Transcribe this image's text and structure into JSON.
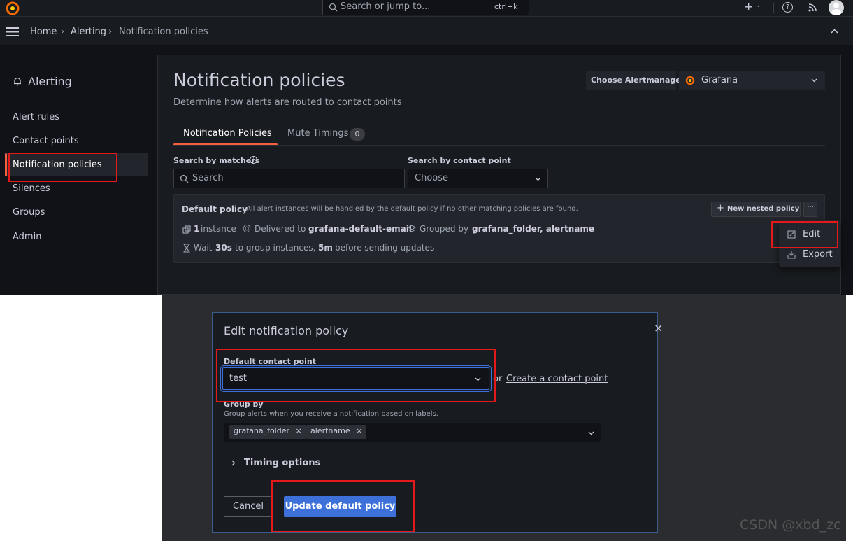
{
  "topbar": {
    "search_placeholder": "Search or jump to...",
    "shortcut": "ctrl+k",
    "plus_label": "+",
    "help_label": "?"
  },
  "breadcrumb": {
    "home": "Home",
    "alerting": "Alerting",
    "current": "Notification policies",
    "separator": "›"
  },
  "sidebar": {
    "title": "Alerting",
    "items": [
      {
        "label": "Alert rules"
      },
      {
        "label": "Contact points"
      },
      {
        "label": "Notification policies",
        "active": true
      },
      {
        "label": "Silences"
      },
      {
        "label": "Groups"
      },
      {
        "label": "Admin"
      }
    ]
  },
  "page": {
    "title": "Notification policies",
    "subtitle": "Determine how alerts are routed to contact points",
    "alertmanager_label": "Choose Alertmanager",
    "alertmanager_value": "Grafana"
  },
  "tabs": [
    {
      "label": "Notification Policies",
      "active": true
    },
    {
      "label": "Mute Timings",
      "count": "0"
    }
  ],
  "filters": {
    "matchers_label": "Search by matchers",
    "matchers_placeholder": "Search",
    "contact_label": "Search by contact point",
    "contact_placeholder": "Choose"
  },
  "policy": {
    "name": "Default policy",
    "description": "All alert instances will be handled by the default policy if no other matching policies are found.",
    "new_nested": "New nested policy",
    "more": "···",
    "instances_count": "1",
    "instances_text": "instance",
    "delivered_prefix": "Delivered to",
    "delivered_to": "grafana-default-email",
    "grouped_prefix": "Grouped by",
    "grouped_by": "grafana_folder, alertname",
    "wait_prefix": "Wait",
    "wait_value": "30s",
    "wait_mid": "to group instances,",
    "repeat_value": "5m",
    "wait_suffix": "before sending updates"
  },
  "menu": {
    "edit": "Edit",
    "export": "Export"
  },
  "modal": {
    "title": "Edit notification policy",
    "close": "×",
    "contact_label": "Default contact point",
    "contact_value": "test",
    "or": "or",
    "create_link": "Create a contact point",
    "group_label": "Group by",
    "group_desc": "Group alerts when you receive a notification based on labels.",
    "group_tags": [
      "grafana_folder",
      "alertname"
    ],
    "timing_label": "Timing options",
    "cancel": "Cancel",
    "submit": "Update default policy"
  },
  "watermark": "CSDN @xbd_zc",
  "colors": {
    "accent": "#f55f3e",
    "primary_button": "#3d71d9",
    "highlight": "#e5191a",
    "background": "#111217"
  }
}
